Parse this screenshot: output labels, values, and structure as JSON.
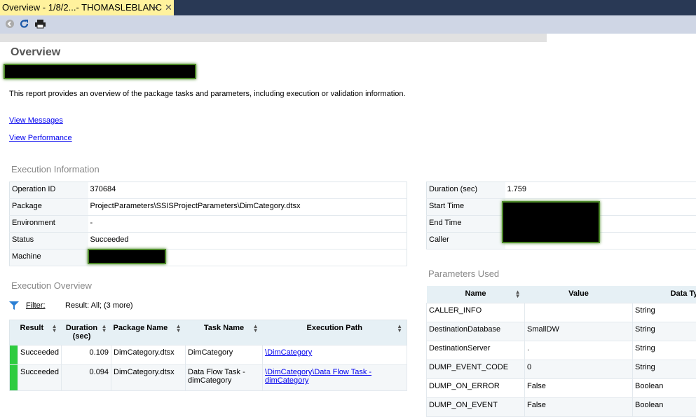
{
  "tab": {
    "title": "Overview - 1/8/2...- THOMASLEBLANC",
    "pin": "⊸",
    "close": "✕"
  },
  "toolbar": {
    "back": "back-icon",
    "refresh": "refresh-icon",
    "print": "print-icon"
  },
  "title": "Overview",
  "description": "This report provides an overview of the package tasks and parameters, including execution or validation information.",
  "links": {
    "messages": "View Messages",
    "performance": "View Performance"
  },
  "execution_info": {
    "heading": "Execution Information",
    "left": [
      {
        "label": "Operation ID",
        "value": "370684"
      },
      {
        "label": "Package",
        "value": "ProjectParameters\\SSISProjectParameters\\DimCategory.dtsx"
      },
      {
        "label": "Environment",
        "value": "-"
      },
      {
        "label": "Status",
        "value": "Succeeded"
      },
      {
        "label": "Machine",
        "value": ""
      }
    ],
    "right": [
      {
        "label": "Duration (sec)",
        "value": "1.759"
      },
      {
        "label": "Start Time",
        "value": ""
      },
      {
        "label": "End Time",
        "value": ""
      },
      {
        "label": "Caller",
        "value": ""
      }
    ]
  },
  "execution_overview": {
    "heading": "Execution Overview",
    "filter_label": "Filter:",
    "filter_value": "Result: All;  (3 more)",
    "columns": [
      "Result",
      "Duration (sec)",
      "Package Name",
      "Task Name",
      "Execution Path"
    ],
    "rows": [
      {
        "result": "Succeeded",
        "duration": "0.109",
        "package": "DimCategory.dtsx",
        "task": "DimCategory",
        "path": "\\DimCategory"
      },
      {
        "result": "Succeeded",
        "duration": "0.094",
        "package": "DimCategory.dtsx",
        "task": "Data Flow Task - dimCategory",
        "path": "\\DimCategory\\Data Flow Task - dimCategory"
      }
    ]
  },
  "parameters": {
    "heading": "Parameters Used",
    "columns": [
      "Name",
      "Value",
      "Data Ty"
    ],
    "rows": [
      {
        "name": "CALLER_INFO",
        "value": "",
        "type": "String"
      },
      {
        "name": "DestinationDatabase",
        "value": "SmallDW",
        "type": "String"
      },
      {
        "name": "DestinationServer",
        "value": ".",
        "type": "String"
      },
      {
        "name": "DUMP_EVENT_CODE",
        "value": "0",
        "type": "String"
      },
      {
        "name": "DUMP_ON_ERROR",
        "value": "False",
        "type": "Boolean"
      },
      {
        "name": "DUMP_ON_EVENT",
        "value": "False",
        "type": "Boolean"
      }
    ]
  }
}
